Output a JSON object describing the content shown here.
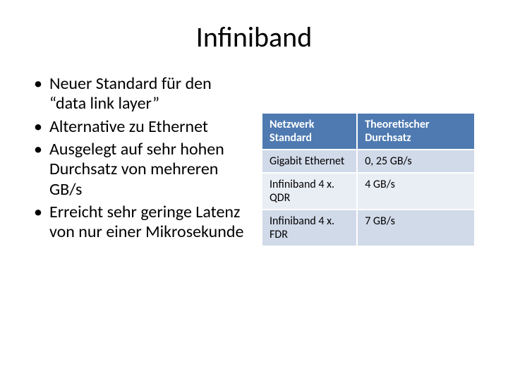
{
  "title": "Infiniband",
  "bullets": [
    "Neuer Standard für den “data link layer”",
    "Alternative zu Ethernet",
    "Ausgelegt auf sehr hohen Durchsatz von mehreren GB/s",
    "Erreicht sehr geringe Latenz von nur einer Mikrosekunde"
  ],
  "table": {
    "headers": [
      "Netzwerk Standard",
      "Theoretischer Durchsatz"
    ],
    "rows": [
      [
        "Gigabit Ethernet",
        "0, 25 GB/s"
      ],
      [
        "Infiniband 4 x. QDR",
        "4 GB/s"
      ],
      [
        "Infiniband 4 x. FDR",
        "7 GB/s"
      ]
    ]
  },
  "chart_data": {
    "type": "table",
    "title": "Infiniband",
    "columns": [
      "Netzwerk Standard",
      "Theoretischer Durchsatz"
    ],
    "rows": [
      {
        "Netzwerk Standard": "Gigabit Ethernet",
        "Theoretischer Durchsatz": "0, 25 GB/s"
      },
      {
        "Netzwerk Standard": "Infiniband 4 x. QDR",
        "Theoretischer Durchsatz": "4 GB/s"
      },
      {
        "Netzwerk Standard": "Infiniband 4 x. FDR",
        "Theoretischer Durchsatz": "7 GB/s"
      }
    ]
  }
}
